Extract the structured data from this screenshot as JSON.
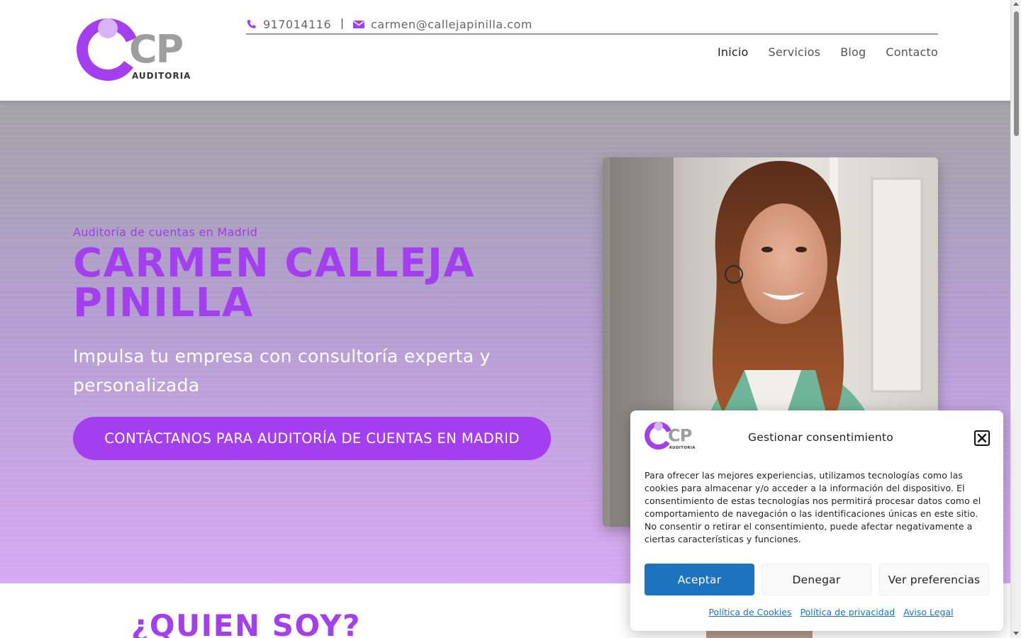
{
  "header": {
    "logo_text": "CP",
    "logo_subtext": "AUDITORIA",
    "phone": "917014116",
    "email": "carmen@callejapinilla.com",
    "nav": [
      {
        "label": "Inicio"
      },
      {
        "label": "Servicios"
      },
      {
        "label": "Blog"
      },
      {
        "label": "Contacto"
      }
    ]
  },
  "hero": {
    "eyebrow": "Auditoría de cuentas en Madrid",
    "title": "CARMEN CALLEJA PINILLA",
    "subtitle": "Impulsa tu empresa con consultoría experta y personalizada",
    "cta_label": "CONTÁCTANOS PARA AUDITORÍA DE CUENTAS EN MADRID"
  },
  "about": {
    "heading": "¿QUIEN SOY?"
  },
  "cookie_modal": {
    "title": "Gestionar consentimiento",
    "body": "Para ofrecer las mejores experiencias, utilizamos tecnologías como las cookies para almacenar y/o acceder a la información del dispositivo. El consentimiento de estas tecnologías nos permitirá procesar datos como el comportamiento de navegación o las identificaciones únicas en este sitio. No consentir o retirar el consentimiento, puede afectar negativamente a ciertas características y funciones.",
    "accept_label": "Aceptar",
    "deny_label": "Denegar",
    "prefs_label": "Ver preferencias",
    "links": [
      {
        "label": "Política de Cookies"
      },
      {
        "label": "Política de privacidad"
      },
      {
        "label": "Aviso Legal"
      }
    ]
  },
  "colors": {
    "brand_purple": "#a43ff0",
    "accept_blue": "#1e73be"
  },
  "icons": {
    "phone": "phone-icon",
    "email": "envelope-icon",
    "close": "close-icon"
  }
}
